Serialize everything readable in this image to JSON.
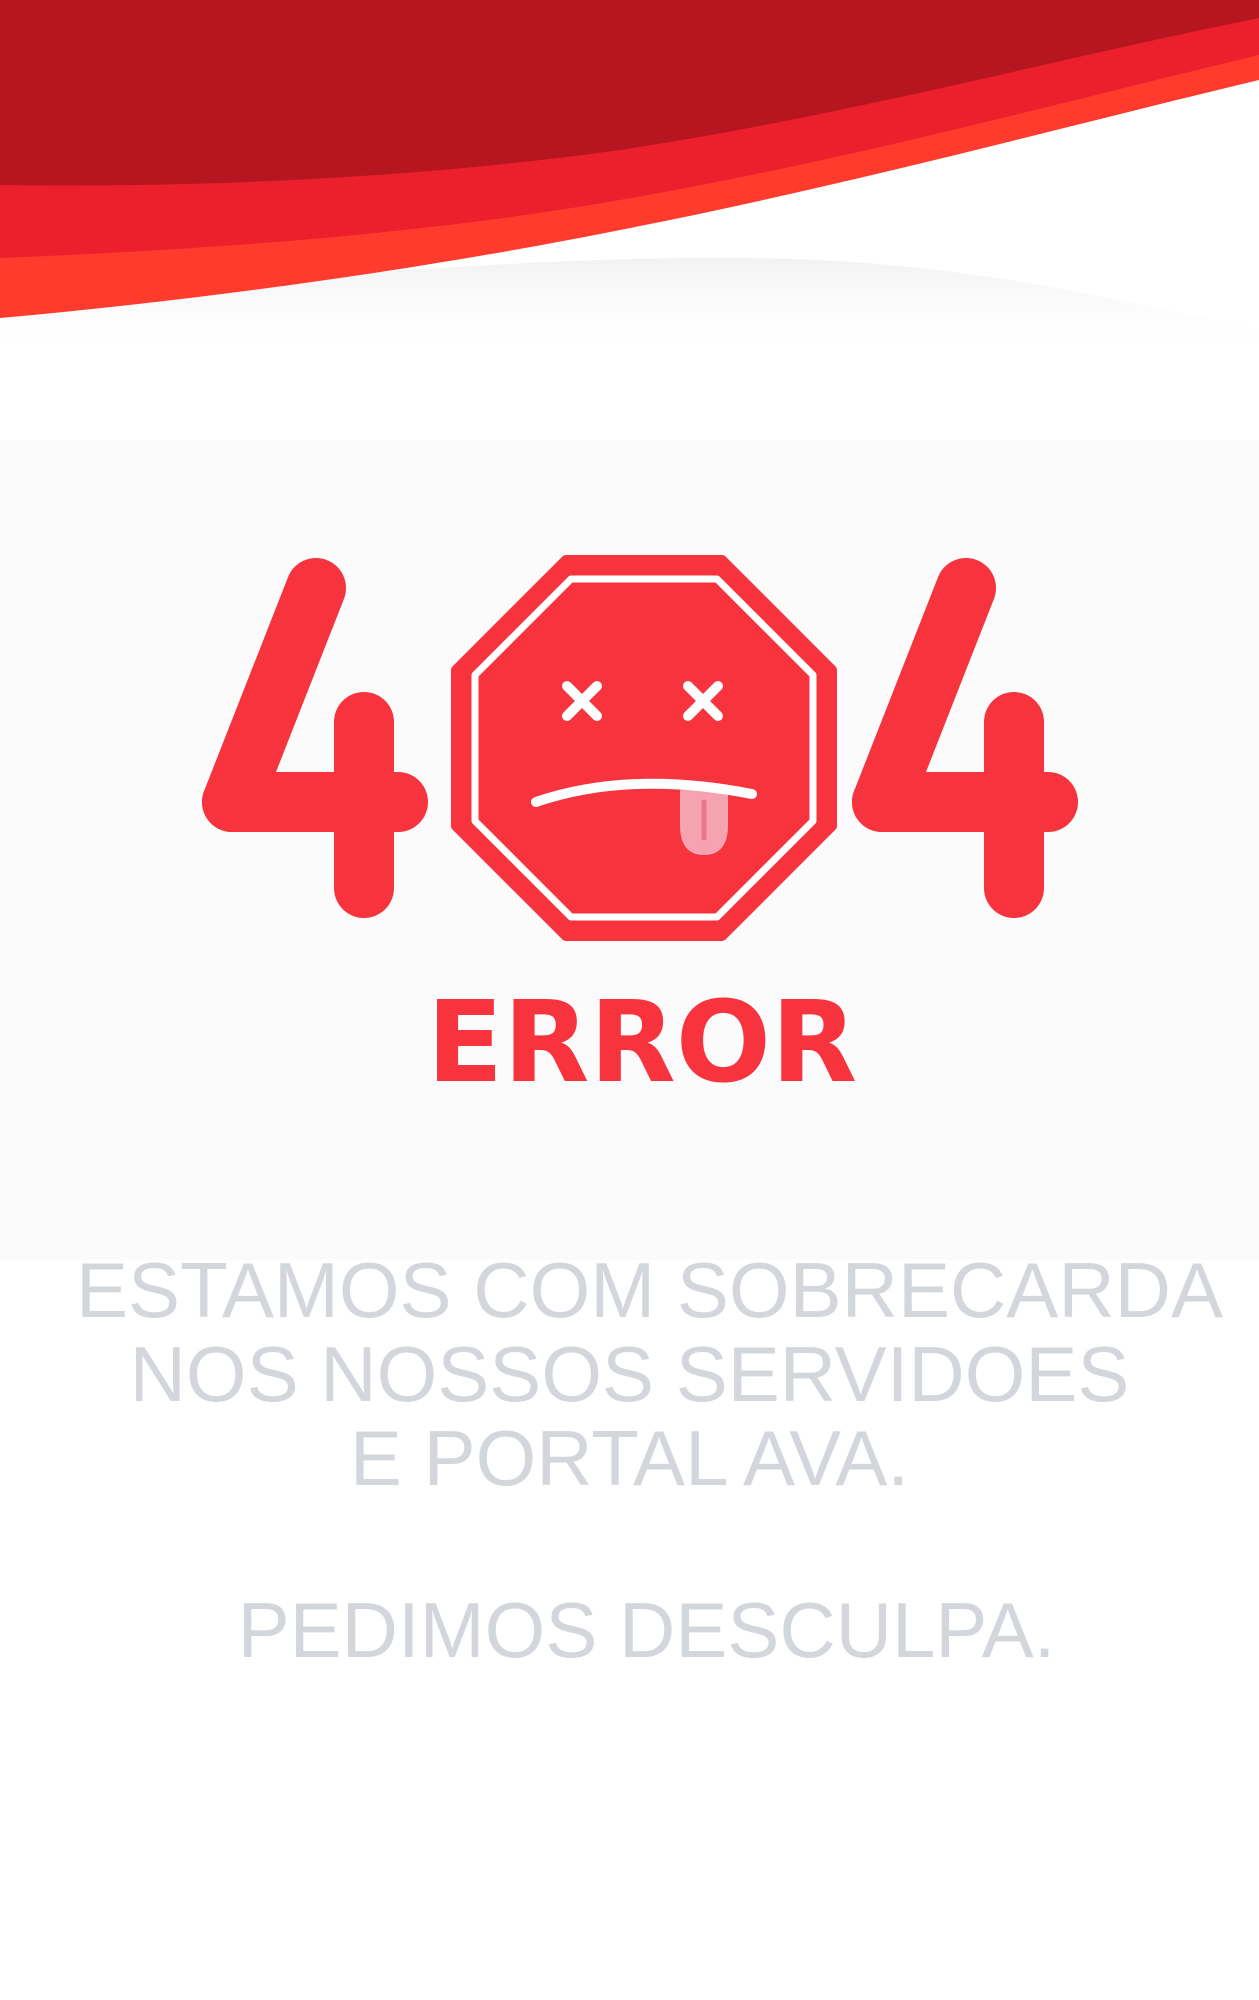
{
  "error": {
    "code_digit_left": "4",
    "code_digit_right": "4",
    "label": "ERROR"
  },
  "colors": {
    "brand_red": "#f7333d",
    "wave_dark": "#b5161f",
    "wave_mid": "#e81e2b",
    "wave_light": "#ff3b2e",
    "tongue": "#f5a3b0",
    "message_text": "#d3d7dc"
  },
  "icons": {
    "emblem": "dead-face-stop-sign-icon"
  },
  "message": {
    "line1": "ESTAMOS COM SOBRECARDA",
    "line2": "NOS NOSSOS SERVIDOES",
    "line3": "E PORTAL AVA.",
    "apology": "PEDIMOS DESCULPA."
  }
}
